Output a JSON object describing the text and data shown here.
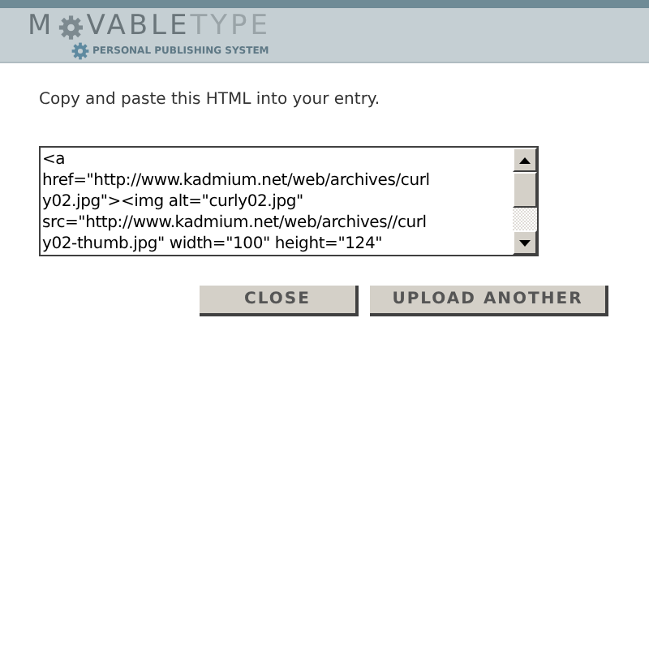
{
  "logo": {
    "first": "M",
    "bold": "VABLE",
    "light": "TYPE",
    "tagline": "PERSONAL PUBLISHING SYSTEM"
  },
  "instruction": "Copy and paste this HTML into your entry.",
  "html_field": {
    "lines": [
      "<a",
      "href=\"http://www.kadmium.net/web/archives/curl",
      "y02.jpg\"><img alt=\"curly02.jpg\"",
      "src=\"http://www.kadmium.net/web/archives//curl",
      "y02-thumb.jpg\" width=\"100\" height=\"124\""
    ]
  },
  "buttons": [
    "CLOSE",
    "UPLOAD ANOTHER"
  ]
}
